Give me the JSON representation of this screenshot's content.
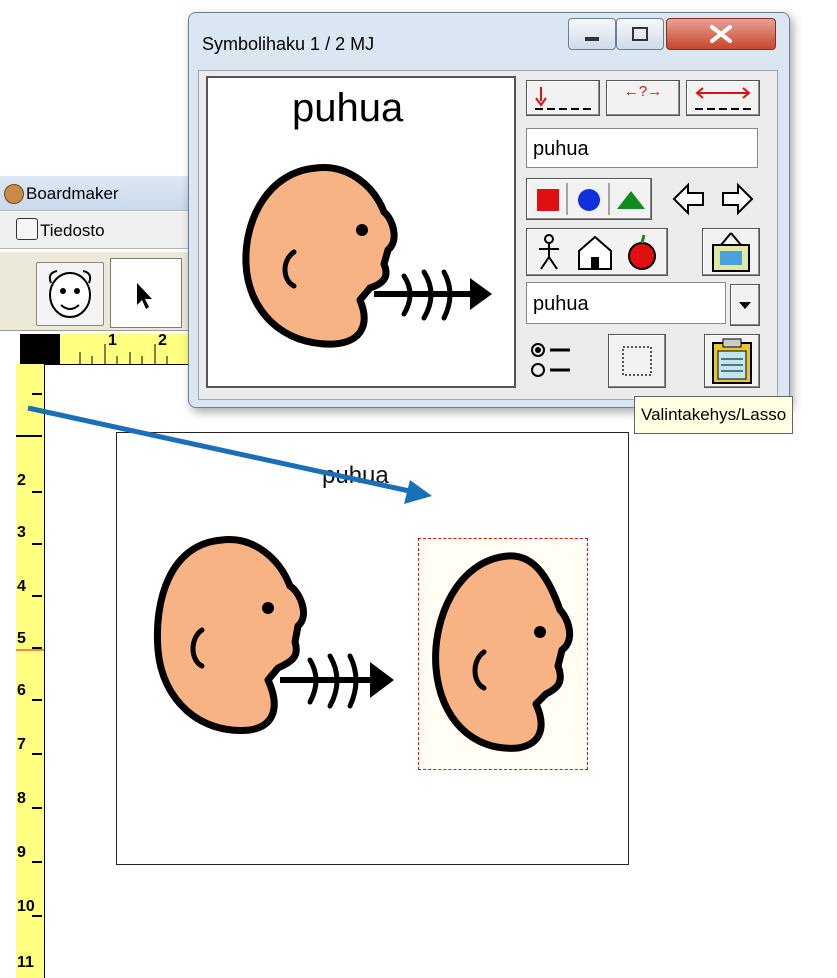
{
  "background_app": {
    "title": "Boardmaker",
    "menu_file": "Tiedosto",
    "ruler_top_marks": [
      "1",
      "2"
    ],
    "ruler_left_marks": [
      "2",
      "3",
      "4",
      "5",
      "6",
      "7",
      "8",
      "9",
      "10",
      "11"
    ]
  },
  "canvas": {
    "symbol_label": "puhua"
  },
  "dialog": {
    "title": "Symbolihaku  1 / 2   MJ",
    "preview_label": "puhua",
    "search_value": "puhua",
    "combo_value": "puhua",
    "mode_button_mid": "←?→"
  },
  "tooltip": {
    "text": "Valintakehys/Lasso"
  },
  "colors": {
    "face_fill": "#f8b384",
    "arrow": "#1a6fb8",
    "selection": "#e01010",
    "ruler": "#ffff80"
  }
}
